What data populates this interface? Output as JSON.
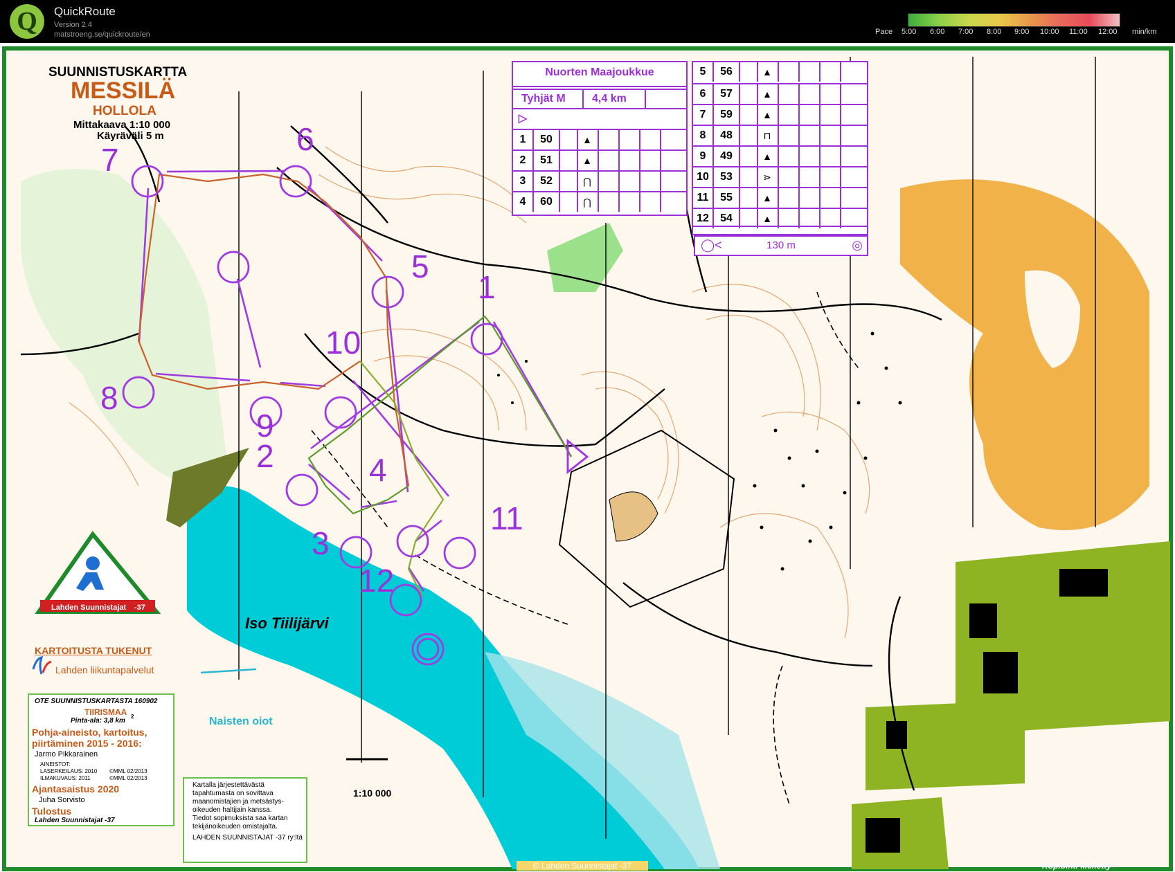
{
  "app": {
    "title": "QuickRoute",
    "version": "Version 2.4",
    "url": "matstroeng.se/quickroute/en"
  },
  "pace_legend": {
    "label": "Pace",
    "ticks": [
      "5:00",
      "6:00",
      "7:00",
      "8:00",
      "9:00",
      "10:00",
      "11:00",
      "12:00"
    ],
    "unit": "min/km",
    "colors": [
      "#3cae3c",
      "#8ad04a",
      "#c8d84a",
      "#e8c84a",
      "#e89a4a",
      "#e86a5a",
      "#e84a5a",
      "#f0c0c0"
    ]
  },
  "map_header": {
    "type_label": "SUUNNISTUSKARTTA",
    "name": "MESSILÄ",
    "municipality": "HOLLOLA",
    "scale": "Mittakaava 1:10 000",
    "contour": "Käyräväli 5 m"
  },
  "course": {
    "event": "Nuorten Maajoukkue",
    "class": "Tyhjät M",
    "length": "4,4 km",
    "finish_distance": "130 m",
    "controls": [
      {
        "n": "1",
        "code": "50",
        "sym": "▲"
      },
      {
        "n": "2",
        "code": "51",
        "sym": "▲"
      },
      {
        "n": "3",
        "code": "52",
        "sym": "⋂"
      },
      {
        "n": "4",
        "code": "60",
        "sym": "⋂"
      },
      {
        "n": "5",
        "code": "56",
        "sym": "▲"
      },
      {
        "n": "6",
        "code": "57",
        "sym": "▲"
      },
      {
        "n": "7",
        "code": "59",
        "sym": "▲"
      },
      {
        "n": "8",
        "code": "48",
        "sym": "⊓"
      },
      {
        "n": "9",
        "code": "49",
        "sym": "▲"
      },
      {
        "n": "10",
        "code": "53",
        "sym": "⋗"
      },
      {
        "n": "11",
        "code": "55",
        "sym": "▲"
      },
      {
        "n": "12",
        "code": "54",
        "sym": "▲"
      }
    ]
  },
  "map_labels": {
    "lake": "Iso Tiilijärvi",
    "women_courses": "Naisten oiot",
    "scale_bar": "1:10 000",
    "club_left": "Lahden Suunnistajat",
    "club_right": "-37",
    "mapping_support": "KARTOITUSTA TUKENUT",
    "support_org": "Lahden liikuntapalvelut",
    "footer_copyright": "© Lahden Suunnistajat -37",
    "footer_nocopy": "Kopiointi kielletty"
  },
  "info_box": {
    "extract": "OTE SUUNNISTUSKARTASTA 160902",
    "area_name": "TIIRISMAA",
    "area_size": "Pinta-ala: 3,8 km",
    "area_sup": "2",
    "basis_title_1": "Pohja-aineisto, kartoitus,",
    "basis_title_2": "piirtäminen 2015 - 2016:",
    "mapper": "Jarmo Pikkarainen",
    "materials": "AINEISTOT:",
    "laser": "LASERKEILAUS: 2010",
    "laser_copy": "©MML 02/2013",
    "aerial": "ILMAKUVAUS: 2011",
    "aerial_copy": "©MML 02/2013",
    "update_title": "Ajantasaistus 2020",
    "updater": "Juha Sorvisto",
    "print_title": "Tulostus",
    "printer": "Lahden Suunnistajat -37"
  },
  "legal_box": {
    "lines": [
      "Kartalla järjestettävästä",
      "tapahtumasta on sovittava",
      "maanomistajien ja metsästys-",
      "oikeuden haltijain kanssa.",
      "Tiedot sopimuksista saa kartan",
      "tekijänoikeuden omistajalta.",
      "LAHDEN SUUNNISTAJAT -37 ry:ltä"
    ]
  },
  "control_numbers": [
    "1",
    "2",
    "3",
    "4",
    "5",
    "6",
    "7",
    "8",
    "9",
    "10",
    "11",
    "12"
  ]
}
